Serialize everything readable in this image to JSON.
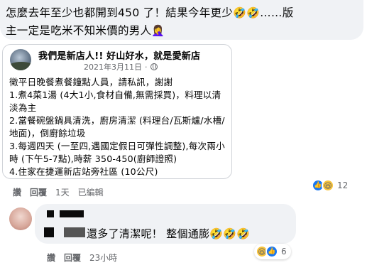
{
  "comment1": {
    "text_a": "怎麼去年至少也都開到450 了！結果今年更少",
    "emoji_a": "🤣🤣",
    "text_b": "……版",
    "text_c": "主一定是吃米不知米價的男人",
    "emoji_c": "🤦‍♀️"
  },
  "shared_post": {
    "page_name": "我們是新店人!! 好山好水，就是愛新店",
    "date": "2021年3月11日",
    "dot": "·",
    "body": "徵平日晚餐煮餐鐘點人員，請私訊，謝謝\n1.煮4菜1湯 (4大1小,食材自備,無需採買)，料理以清淡為主\n2.當餐碗盤鍋具清洗，廚房清潔 (料理台/瓦斯爐/水槽/地面)，倒廚餘垃圾\n3.每週四天 (一至四,遇國定假日可彈性調整),每次兩小時 (下午5-7點),時薪 350-450(廚師證照)\n4.住家在捷運新店站旁社區 (10公尺)"
  },
  "comment1_actions": {
    "like": "讚",
    "reply": "回覆",
    "time": "1天",
    "edited": "已編輯"
  },
  "comment1_reactions": {
    "count": "12"
  },
  "comment2": {
    "text": "還多了清潔呢！ 整個通膨",
    "emoji": "🤣🤣🤣"
  },
  "comment2_actions": {
    "like": "讚",
    "reply": "回覆",
    "time": "23小時"
  },
  "comment2_reactions": {
    "count": "6"
  },
  "colors": {
    "bubble": "#f0f2f5",
    "meta_text": "#65676b",
    "like_blue": "#1877f2",
    "haha_yellow": "#f7c33b"
  }
}
